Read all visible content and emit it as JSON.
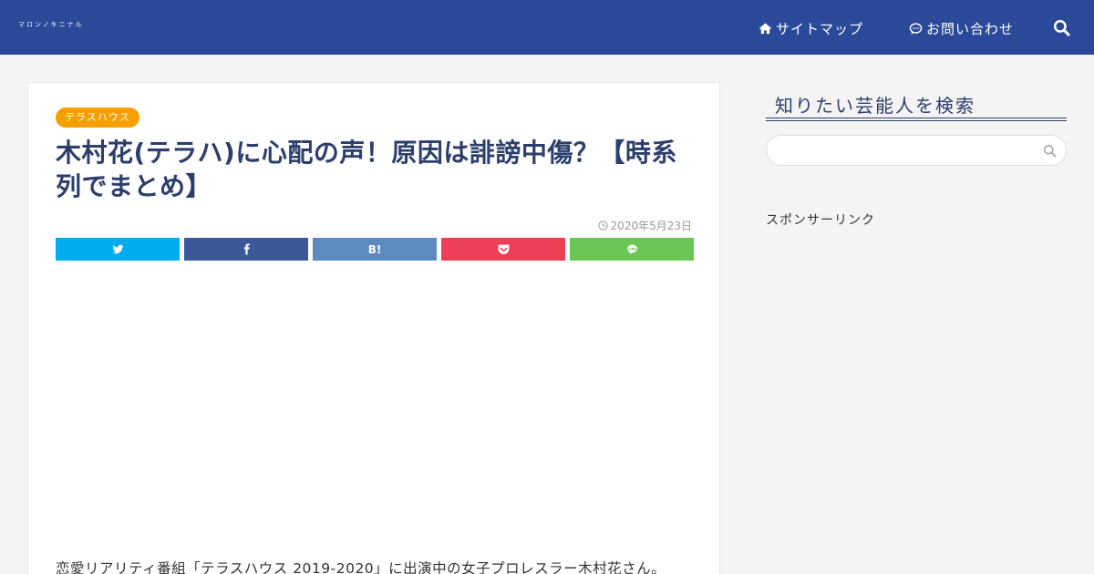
{
  "header": {
    "site_title": "マロンノキニナル",
    "nav": [
      {
        "label": "サイトマップ",
        "icon": "home-icon"
      },
      {
        "label": "お問い合わせ",
        "icon": "chat-icon"
      }
    ],
    "search_icon": "search-icon",
    "bg_color": "#2a4a99"
  },
  "article": {
    "category": "テラスハウス",
    "title": "木村花(テラハ)に心配の声！原因は誹謗中傷？【時系列でまとめ】",
    "date": "2020年5月23日",
    "share_buttons": [
      {
        "service": "twitter",
        "label": "",
        "color": "#00acee"
      },
      {
        "service": "facebook",
        "label": "",
        "color": "#3b5998"
      },
      {
        "service": "hatena",
        "label": "B!",
        "color": "#5d8ac1"
      },
      {
        "service": "pocket",
        "label": "",
        "color": "#ef3f56"
      },
      {
        "service": "line",
        "label": "",
        "color": "#6cc655"
      }
    ],
    "intro": "恋愛リアリティ番組「テラスハウス 2019-2020」に出演中の女子プロレスラー木村花さん。"
  },
  "sidebar": {
    "search_heading": "知りたい芸能人を検索",
    "search_placeholder": "",
    "sponsor_label": "スポンサーリンク"
  }
}
